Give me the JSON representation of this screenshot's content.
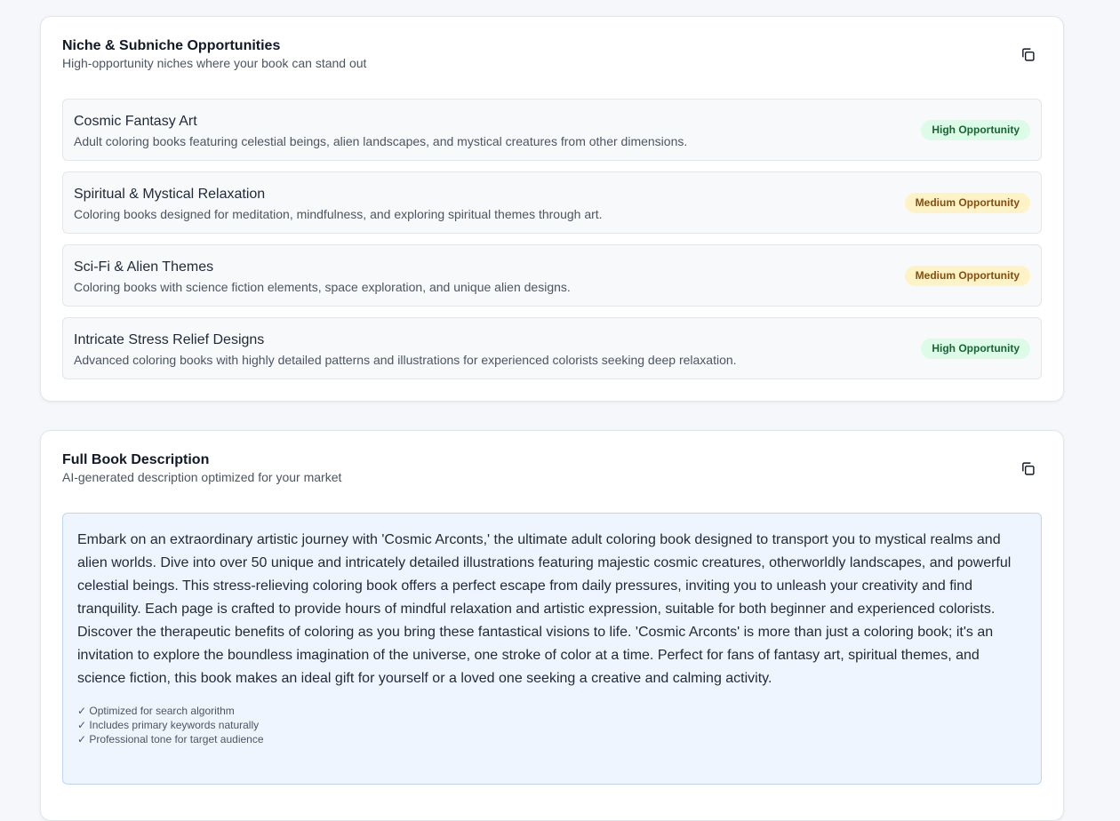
{
  "niche_card": {
    "title": "Niche & Subniche Opportunities",
    "subtitle": "High-opportunity niches where your book can stand out",
    "copy_icon": "copy-icon",
    "items": [
      {
        "name": "Cosmic Fantasy Art",
        "description": "Adult coloring books featuring celestial beings, alien landscapes, and mystical creatures from other dimensions.",
        "badge": "High Opportunity",
        "level": "high"
      },
      {
        "name": "Spiritual & Mystical Relaxation",
        "description": "Coloring books designed for meditation, mindfulness, and exploring spiritual themes through art.",
        "badge": "Medium Opportunity",
        "level": "medium"
      },
      {
        "name": "Sci-Fi & Alien Themes",
        "description": "Coloring books with science fiction elements, space exploration, and unique alien designs.",
        "badge": "Medium Opportunity",
        "level": "medium"
      },
      {
        "name": "Intricate Stress Relief Designs",
        "description": "Advanced coloring books with highly detailed patterns and illustrations for experienced colorists seeking deep relaxation.",
        "badge": "High Opportunity",
        "level": "high"
      }
    ]
  },
  "description_card": {
    "title": "Full Book Description",
    "subtitle": "AI-generated description optimized for your market",
    "copy_icon": "copy-icon",
    "text": "Embark on an extraordinary artistic journey with 'Cosmic Arconts,' the ultimate adult coloring book designed to transport you to mystical realms and alien worlds. Dive into over 50 unique and intricately detailed illustrations featuring majestic cosmic creatures, otherworldly landscapes, and powerful celestial beings. This stress-relieving coloring book offers a perfect escape from daily pressures, inviting you to unleash your creativity and find tranquility. Each page is crafted to provide hours of mindful relaxation and artistic expression, suitable for both beginner and experienced colorists. Discover the therapeutic benefits of coloring as you bring these fantastical visions to life. 'Cosmic Arconts' is more than just a coloring book; it's an invitation to explore the boundless imagination of the universe, one stroke of color at a time. Perfect for fans of fantasy art, spiritual themes, and science fiction, this book makes an ideal gift for yourself or a loved one seeking a creative and calming activity.",
    "checklist": [
      "✓ Optimized for search algorithm",
      "✓ Includes primary keywords naturally",
      "✓ Professional tone for target audience"
    ]
  },
  "colors": {
    "high_badge_bg": "#dcfce7",
    "high_badge_text": "#166534",
    "medium_badge_bg": "#fef3c7",
    "medium_badge_text": "#854d0e",
    "description_bg": "#eef5ff"
  }
}
